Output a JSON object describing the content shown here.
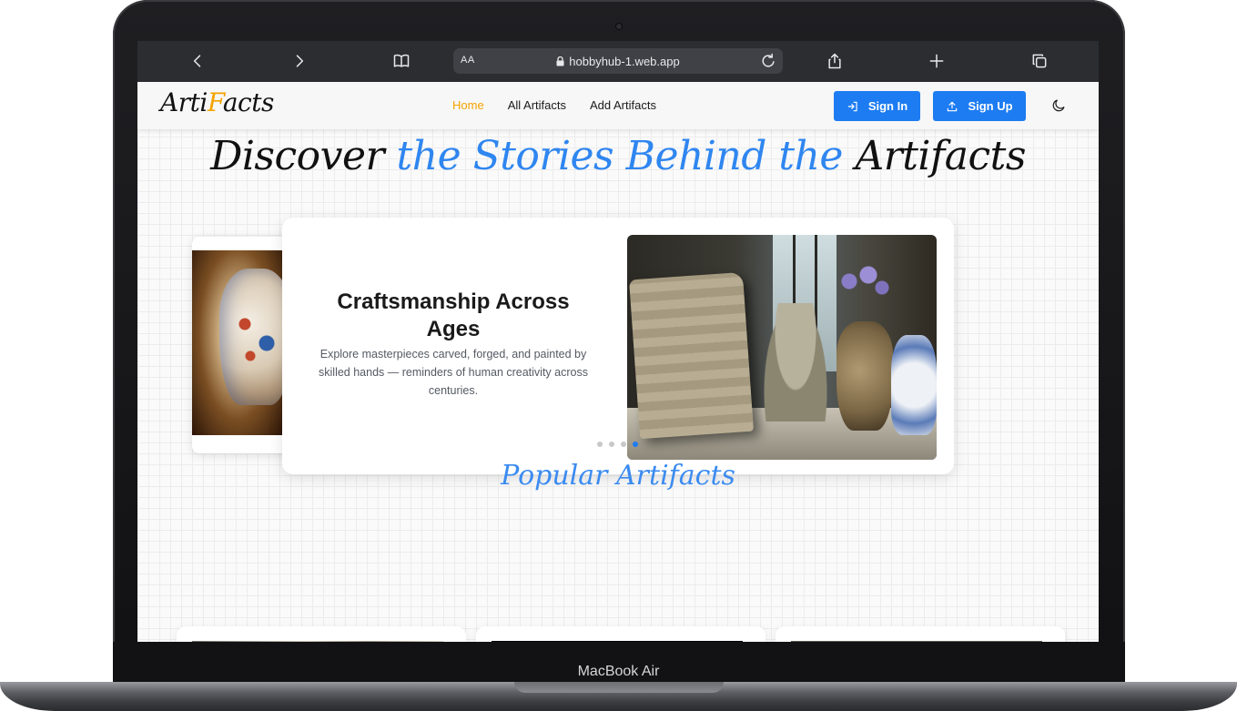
{
  "device": {
    "label": "MacBook Air"
  },
  "browser": {
    "text_size_label": "AA",
    "url": "hobbyhub-1.web.app",
    "icons": [
      "back-icon",
      "forward-icon",
      "bookmarks-icon",
      "lock-icon",
      "reload-icon",
      "share-icon",
      "new-tab-icon",
      "tabs-overview-icon"
    ]
  },
  "site": {
    "logo": {
      "part1": "Arti",
      "part2": "F",
      "part3": "acts"
    },
    "nav": [
      {
        "label": "Home",
        "active": true
      },
      {
        "label": "All Artifacts",
        "active": false
      },
      {
        "label": "Add Artifacts",
        "active": false
      }
    ],
    "sign_in": "Sign In",
    "sign_up": "Sign Up",
    "theme_icon": "moon-icon"
  },
  "hero": {
    "title_part1": "Discover ",
    "title_part2": "the Stories Behind the",
    "title_part3": " Artifacts"
  },
  "slider": {
    "title": "Craftsmanship Across Ages",
    "description": "Explore masterpieces carved, forged, and painted by skilled hands — reminders of human creativity across centuries.",
    "dot_count": 4,
    "active_dot": 4
  },
  "popular": {
    "title": "Popular Artifacts"
  },
  "colors": {
    "accent_blue": "#1d7cf2",
    "title_blue": "#2f86f0",
    "active_nav": "#f5a300"
  }
}
